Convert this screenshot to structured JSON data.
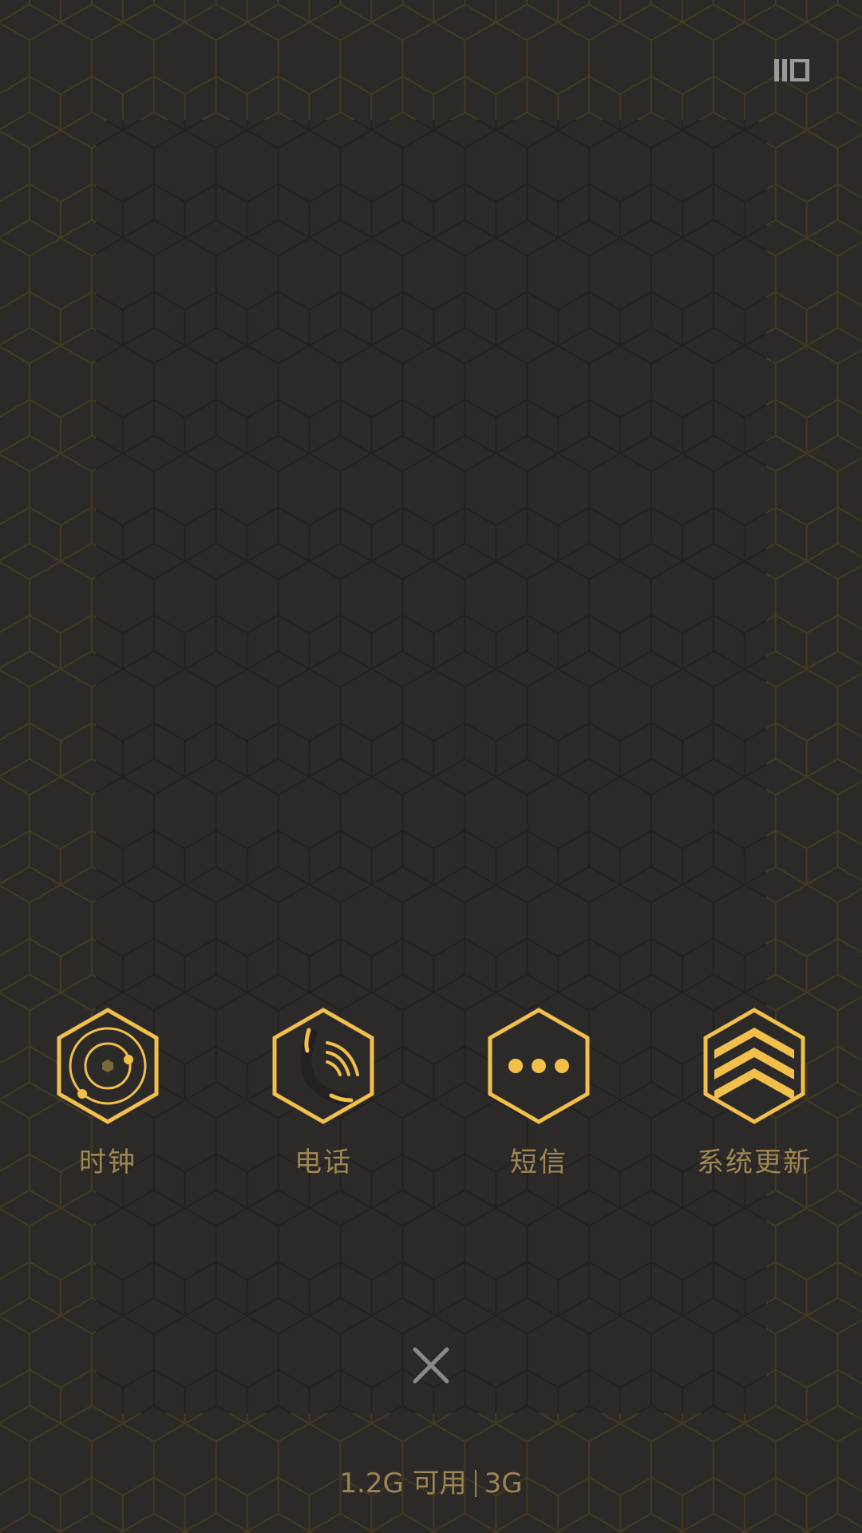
{
  "colors": {
    "background": "#2b2a29",
    "accent": "#f2c04a",
    "label": "#a08650",
    "close": "#8a8a8a"
  },
  "header": {
    "toggle_icon": "list-toggle-icon"
  },
  "apps": [
    {
      "label": "时钟",
      "icon": "clock-orbit-icon"
    },
    {
      "label": "电话",
      "icon": "phone-signal-icon"
    },
    {
      "label": "短信",
      "icon": "message-dots-icon"
    },
    {
      "label": "系统更新",
      "icon": "chevrons-up-icon"
    }
  ],
  "footer": {
    "close_icon": "close-icon",
    "memory_available": "1.2G 可用",
    "memory_total": "3G"
  }
}
